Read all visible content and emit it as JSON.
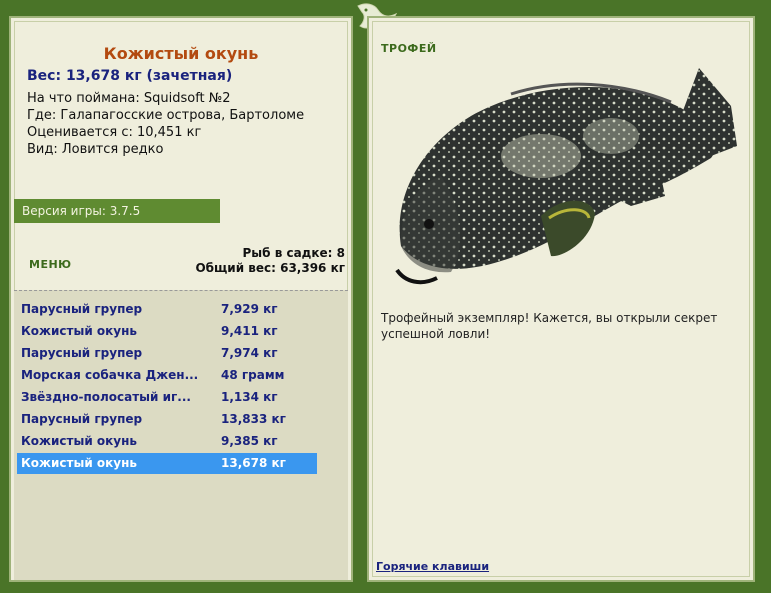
{
  "fish": {
    "title": "Кожистый окунь",
    "weight": "Вес: 13,678 кг (зачетная)",
    "caught_with": "На что поймана: Squidsoft №2",
    "location": "Где: Галапагосские острова, Бартоломе",
    "rated_from": "Оценивается с: 10,451 кг",
    "kind": "Вид: Ловится редко"
  },
  "version": "Версия игры: 3.7.5",
  "menu_label": "МЕНЮ",
  "cage": {
    "count": "Рыб в садке: 8",
    "total": "Общий вес: 63,396 кг"
  },
  "catch_list": [
    {
      "name": "Парусный групер",
      "weight": "7,929 кг"
    },
    {
      "name": "Кожистый окунь",
      "weight": "9,411 кг"
    },
    {
      "name": "Парусный групер",
      "weight": "7,974 кг"
    },
    {
      "name": "Морская собачка Джен...",
      "weight": "48 грамм"
    },
    {
      "name": "Звёздно-полосатый иг...",
      "weight": "1,134 кг"
    },
    {
      "name": "Парусный групер",
      "weight": "13,833 кг"
    },
    {
      "name": "Кожистый окунь",
      "weight": "9,385 кг"
    },
    {
      "name": "Кожистый окунь",
      "weight": "13,678 кг"
    }
  ],
  "selected_index": 7,
  "trophy_label": "ТРОФЕЙ",
  "trophy_text": "Трофейный экземпляр! Кажется, вы открыли секрет успешной ловли!",
  "hotkeys": "Горячие клавиши",
  "colors": {
    "frame": "#4a7428",
    "panel": "#efeedc",
    "title": "#b34a10",
    "text_blue": "#1a237e",
    "selection": "#3a97ef"
  }
}
